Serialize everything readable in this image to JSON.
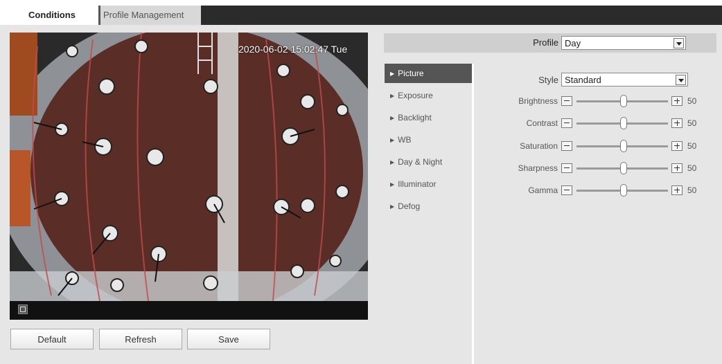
{
  "tabs": [
    {
      "label": "Conditions"
    },
    {
      "label": "Profile Management"
    }
  ],
  "video": {
    "timestamp": "2020-06-02 15:02:47 Tue"
  },
  "buttons": {
    "default": "Default",
    "refresh": "Refresh",
    "save": "Save"
  },
  "profile": {
    "label": "Profile",
    "value": "Day"
  },
  "menu": [
    {
      "label": "Picture"
    },
    {
      "label": "Exposure"
    },
    {
      "label": "Backlight"
    },
    {
      "label": "WB"
    },
    {
      "label": "Day & Night"
    },
    {
      "label": "Illuminator"
    },
    {
      "label": "Defog"
    }
  ],
  "style": {
    "label": "Style",
    "value": "Standard"
  },
  "sliders": [
    {
      "label": "Brightness",
      "value": "50"
    },
    {
      "label": "Contrast",
      "value": "50"
    },
    {
      "label": "Saturation",
      "value": "50"
    },
    {
      "label": "Sharpness",
      "value": "50"
    },
    {
      "label": "Gamma",
      "value": "50"
    }
  ],
  "colors": {
    "active_menu": "#555555",
    "tab_strip": "#2b2b2b",
    "panel": "#e6e6e6"
  }
}
